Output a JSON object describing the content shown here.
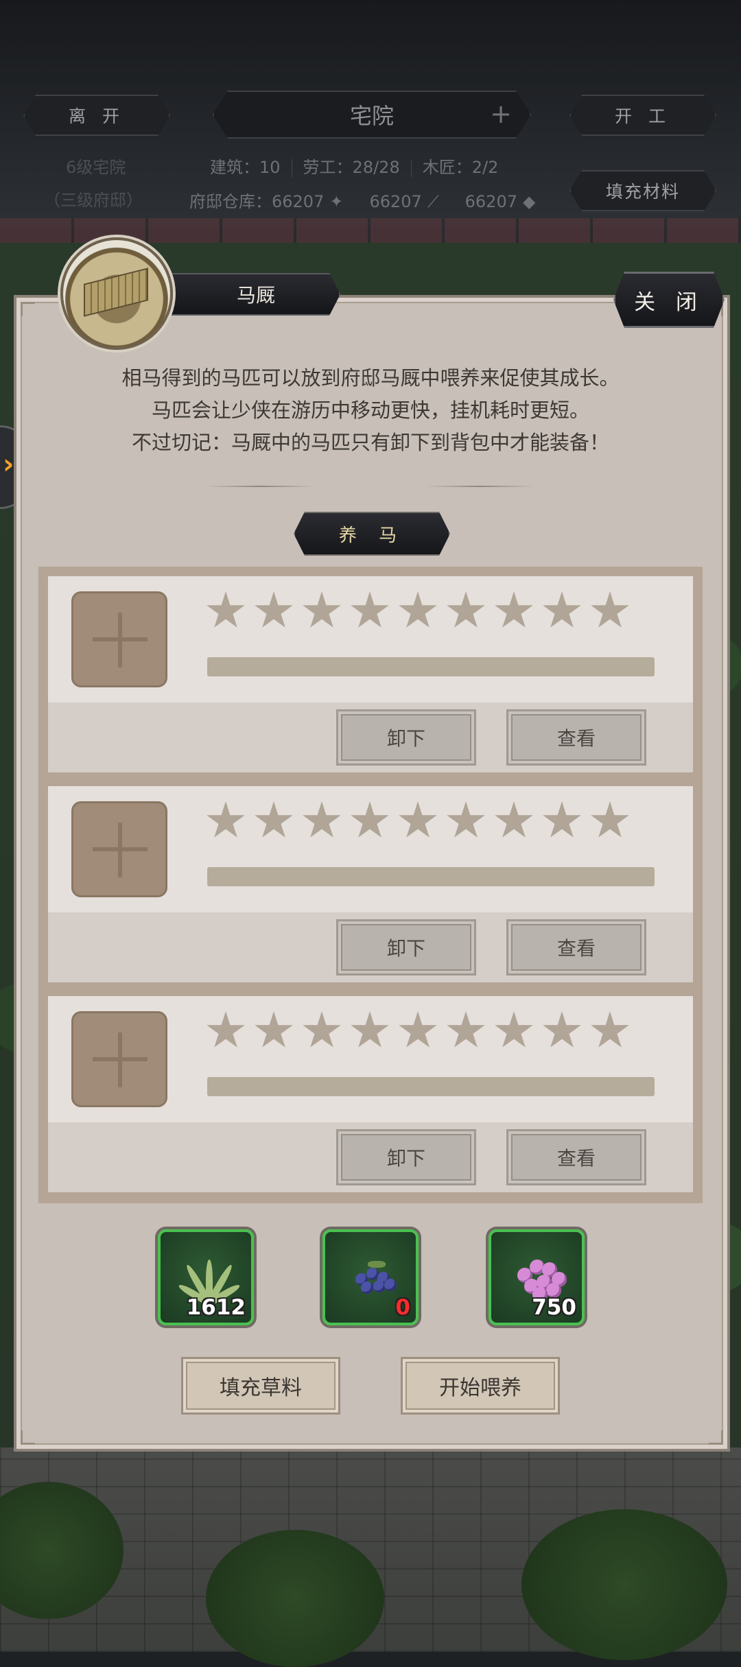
{
  "hud": {
    "leave_label": "离 开",
    "title": "宅院",
    "title_plus": "+",
    "start_work_label": "开 工",
    "level_text": "6级宅院",
    "level_sub": "（三级府邸）",
    "building_label": "建筑：10",
    "labor_label": "劳工：28/28",
    "carpenter_label": "木匠：2/2",
    "warehouse_label": "府邸仓库：",
    "warehouse_values": [
      "66207",
      "66207",
      "66207"
    ],
    "fill_materials_label": "填充材料"
  },
  "panel": {
    "title": "马厩",
    "close_label": "关 闭",
    "description": [
      "相马得到的马匹可以放到府邸马厩中喂养来促使其成长。",
      "马匹会让少侠在游历中移动更快，挂机耗时更短。",
      "不过切记：马厩中的马匹只有卸下到背包中才能装备！"
    ],
    "section_tab": "养 马",
    "slots": [
      {
        "unload_label": "卸下",
        "view_label": "查看",
        "stars_filled": 0,
        "stars_total": 9,
        "progress": 0
      },
      {
        "unload_label": "卸下",
        "view_label": "查看",
        "stars_filled": 0,
        "stars_total": 9,
        "progress": 0
      },
      {
        "unload_label": "卸下",
        "view_label": "查看",
        "stars_filled": 0,
        "stars_total": 9,
        "progress": 0
      }
    ],
    "feeds": [
      {
        "icon": "grass-icon",
        "count": "1612"
      },
      {
        "icon": "blueberry-icon",
        "count": "0"
      },
      {
        "icon": "flower-icon",
        "count": "750"
      }
    ],
    "fill_feed_label": "填充草料",
    "start_feed_label": "开始喂养"
  },
  "colors": {
    "panel_bg": "#c8bfb8",
    "feed_border": "#4ac150",
    "zero_count": "#ff2b2b",
    "tab_text": "#e6d8a3"
  }
}
